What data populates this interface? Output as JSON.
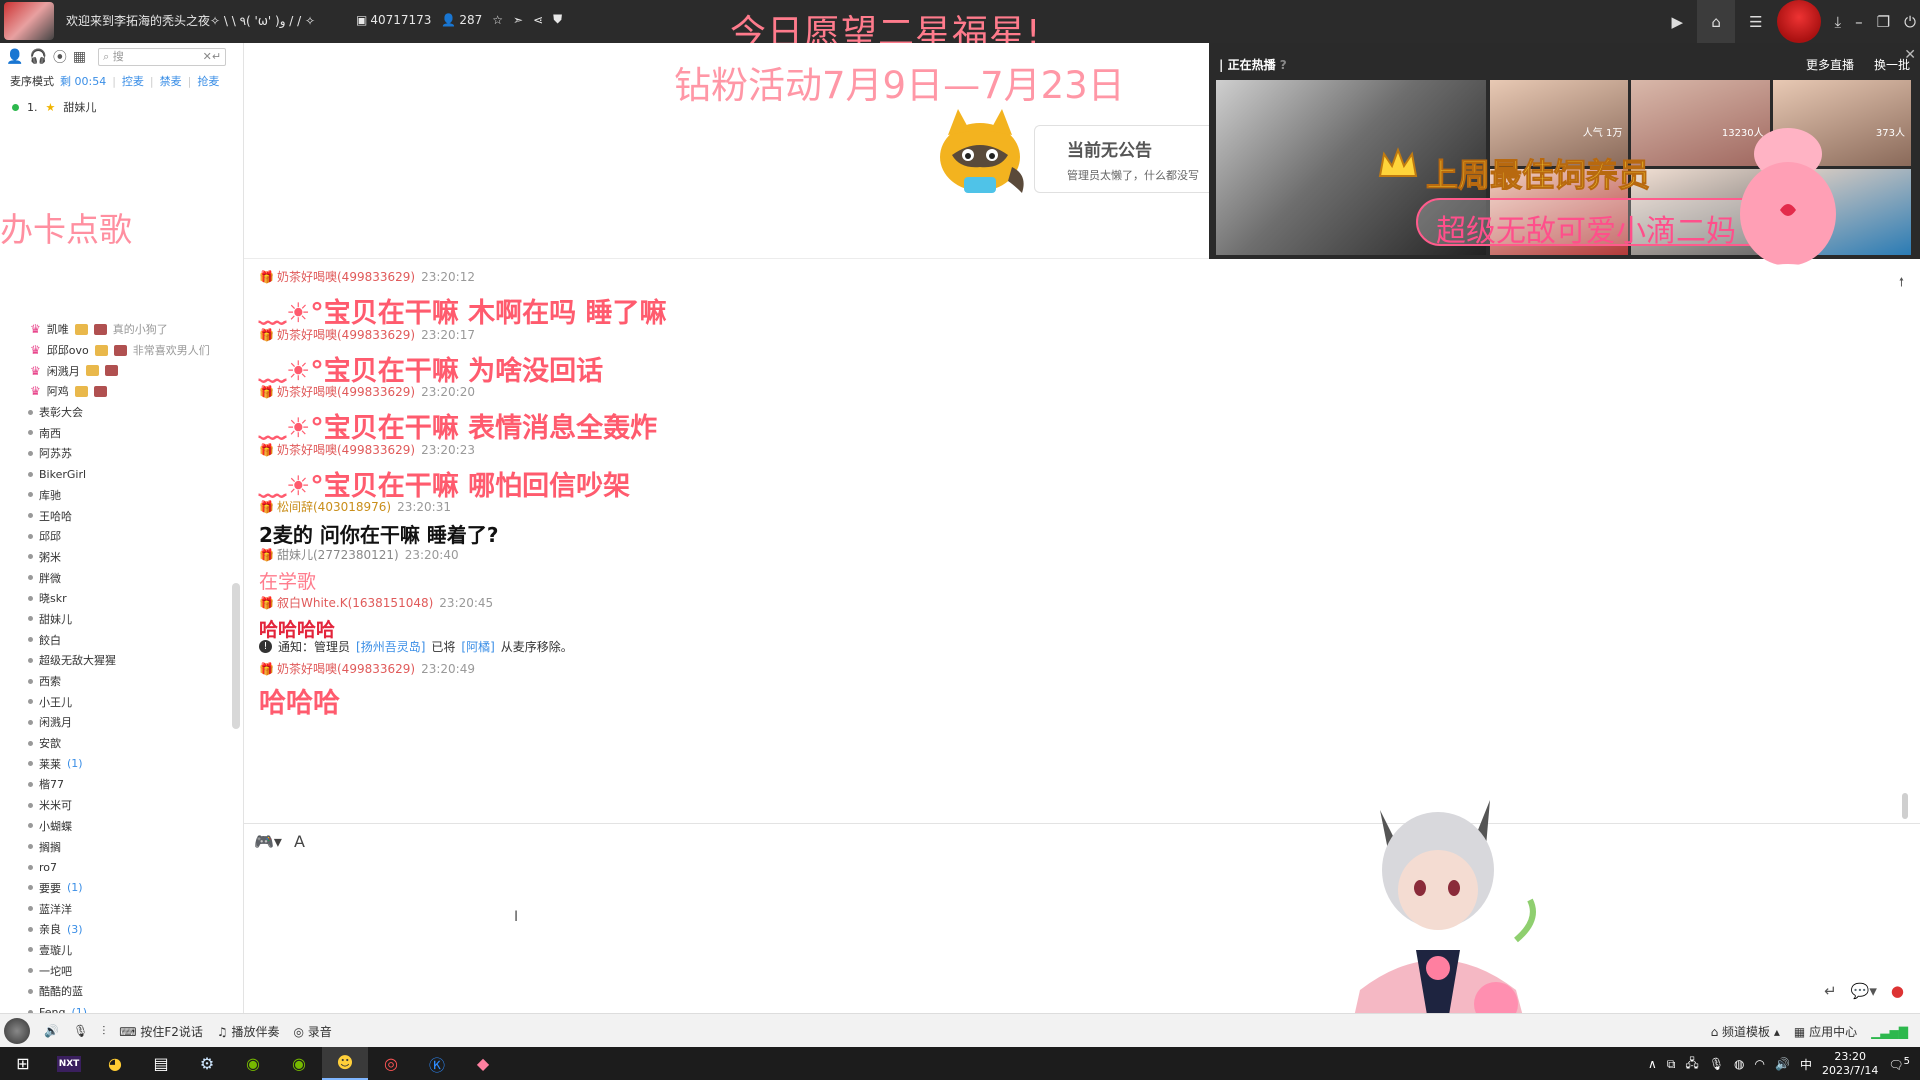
{
  "titlebar": {
    "title": "欢迎来到李拓海的秃头之夜✧ \\ \\ ٩( 'ω' )و / / ✧",
    "room_id": "40717173",
    "online_count": "287",
    "banner": "今日愿望二星福星!",
    "icons": [
      "video-icon",
      "home-icon",
      "list-icon",
      "download-icon",
      "minimize-icon",
      "restore-icon",
      "power-icon"
    ]
  },
  "sidebar": {
    "search_placeholder": "搜",
    "mode_label": "麦序模式",
    "mode_time": "剩 00:54",
    "mode_links": [
      "控麦",
      "禁麦",
      "抢麦"
    ],
    "queue": [
      {
        "index": "1.",
        "name": "甜妹儿"
      }
    ],
    "song_text": "办卡点歌",
    "members": [
      {
        "name": "凯唯",
        "note": "真的小狗了",
        "sub": true
      },
      {
        "name": "邱邱ovo",
        "note": "非常喜欢男人们",
        "sub": true
      },
      {
        "name": "闲溅月",
        "note": "",
        "sub": true
      },
      {
        "name": "阿鸡",
        "note": "",
        "sub": true
      },
      {
        "name": "表彰大会",
        "count": ""
      },
      {
        "name": "南西",
        "count": ""
      },
      {
        "name": "阿苏苏",
        "count": ""
      },
      {
        "name": "BikerGirl",
        "count": ""
      },
      {
        "name": "库驰",
        "count": ""
      },
      {
        "name": "王哈哈",
        "count": ""
      },
      {
        "name": "邱邱",
        "count": ""
      },
      {
        "name": "粥米",
        "count": ""
      },
      {
        "name": "胖微",
        "count": ""
      },
      {
        "name": "晓skr",
        "count": ""
      },
      {
        "name": "甜妹儿",
        "count": ""
      },
      {
        "name": "餃白",
        "count": ""
      },
      {
        "name": "超级无敌大猩猩",
        "count": ""
      },
      {
        "name": "西索",
        "count": ""
      },
      {
        "name": "小王儿",
        "count": ""
      },
      {
        "name": "闲溅月",
        "count": ""
      },
      {
        "name": "安歆",
        "count": ""
      },
      {
        "name": "莱莱",
        "count": "(1)"
      },
      {
        "name": "楷77",
        "count": ""
      },
      {
        "name": "米米可",
        "count": ""
      },
      {
        "name": "小蝴蝶",
        "count": ""
      },
      {
        "name": "搁搁",
        "count": ""
      },
      {
        "name": "ro7",
        "count": ""
      },
      {
        "name": "要要",
        "count": "(1)"
      },
      {
        "name": "蓝洋洋",
        "count": ""
      },
      {
        "name": "亲良",
        "count": "(3)"
      },
      {
        "name": "壹璇儿",
        "count": ""
      },
      {
        "name": "一坨吧",
        "count": ""
      },
      {
        "name": "酷酷的蓝",
        "count": ""
      },
      {
        "name": "Feng",
        "count": "(1)"
      }
    ]
  },
  "announcement": {
    "event": "钻粉活动7月9日—7月23日",
    "card_title": "当前无公告",
    "card_subtitle": "管理员太懒了，什么都没写"
  },
  "hot": {
    "header": "正在热播",
    "refresh": "换一批",
    "more": "更多直播",
    "best_title": "上周最佳饲养员",
    "best_name": "超级无敌可爱小滴二妈",
    "viewers": [
      "人气 1万",
      "13230人",
      "373人"
    ]
  },
  "chat": {
    "messages": [
      {
        "user": "奶茶好喝噢(499833629)",
        "time": "23:20:12",
        "text": "﹏☀°宝贝在干嘛 木啊在吗 睡了嘛",
        "style": "big"
      },
      {
        "user": "奶茶好喝噢(499833629)",
        "time": "23:20:17",
        "text": "﹏☀°宝贝在干嘛 为啥没回话",
        "style": "big"
      },
      {
        "user": "奶茶好喝噢(499833629)",
        "time": "23:20:20",
        "text": "﹏☀°宝贝在干嘛 表情消息全轰炸",
        "style": "big"
      },
      {
        "user": "奶茶好喝噢(499833629)",
        "time": "23:20:23",
        "text": "﹏☀°宝贝在干嘛 哪怕回信吵架",
        "style": "big"
      },
      {
        "user": "松间辞(403018976)",
        "time": "23:20:31",
        "text": "2麦的 问你在干嘛  睡着了?",
        "style": "dark"
      },
      {
        "user": "甜妹儿(2772380121)",
        "time": "23:20:40",
        "text": "在学歌",
        "style": "soft"
      },
      {
        "user": "叙白White.K(1638151048)",
        "time": "23:20:45",
        "text": "哈哈哈哈",
        "style": "red"
      }
    ],
    "notice": {
      "prefix": "通知：管理员",
      "admin": "[扬州吾灵岛]",
      "mid": "已将",
      "target": "[阿橘]",
      "suffix": "从麦序移除。"
    },
    "last": {
      "user": "奶茶好喝噢(499833629)",
      "time": "23:20:49",
      "text": "哈哈哈"
    }
  },
  "statusbar": {
    "push_to_talk": "按住F2说话",
    "accompany": "播放伴奏",
    "record": "录音",
    "channel_template": "频道模板",
    "app_center": "应用中心"
  },
  "taskbar": {
    "apps": [
      "windows-icon",
      "next-icon",
      "chrome-icon",
      "terminal-icon",
      "steam-icon",
      "nvidia-icon",
      "nvidia2-icon",
      "game-icon",
      "browser-icon",
      "kugou-icon",
      "pink-app-icon"
    ],
    "next_label": "NXT",
    "ime": "中",
    "time": "23:20",
    "date": "2023/7/14",
    "notif_count": "5"
  },
  "colors": {
    "accent_pink": "#ff5b6e",
    "link_blue": "#3a8ee6",
    "dark_bg": "#2b2b2b"
  }
}
